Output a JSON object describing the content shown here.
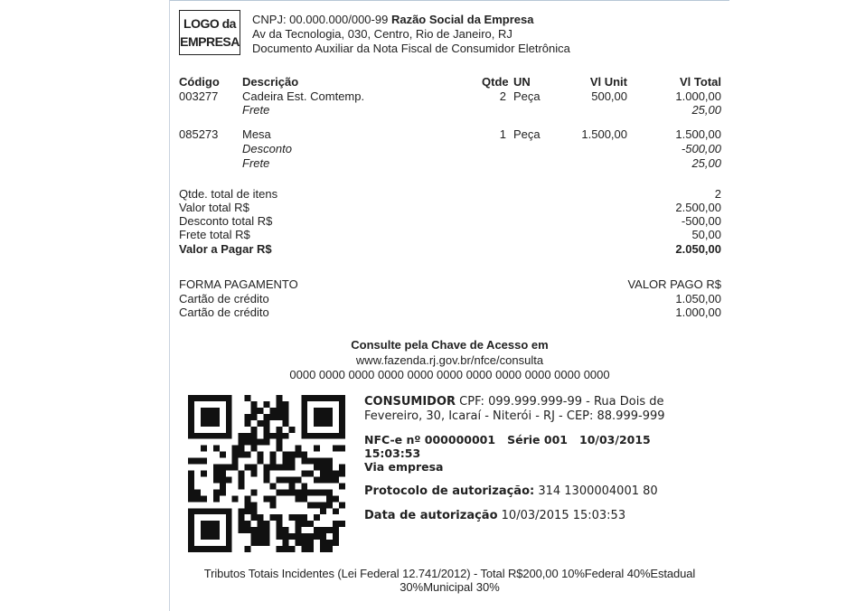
{
  "header": {
    "logo_line1": "LOGO da",
    "logo_line2": "EMPRESA",
    "cnpj": "CNPJ: 00.000.000/000-99",
    "razao_social": "Razão Social da Empresa",
    "address": "Av da Tecnologia, 030, Centro, Rio de Janeiro, RJ",
    "doc_title": "Documento Auxiliar da Nota Fiscal de Consumidor Eletrônica"
  },
  "items_header": {
    "codigo": "Código",
    "descricao": "Descrição",
    "qtde": "Qtde",
    "un": "UN",
    "vl_unit": "Vl Unit",
    "vl_total": "Vl Total"
  },
  "items": [
    {
      "codigo": "003277",
      "descricao": "Cadeira Est. Comtemp.",
      "qtde": "2",
      "un": "Peça",
      "vl_unit": "500,00",
      "vl_total": "1.000,00",
      "extras": [
        {
          "label": "Frete",
          "value": "25,00"
        }
      ]
    },
    {
      "codigo": "085273",
      "descricao": "Mesa",
      "qtde": "1",
      "un": "Peça",
      "vl_unit": "1.500,00",
      "vl_total": "1.500,00",
      "extras": [
        {
          "label": "Desconto",
          "value": "-500,00"
        },
        {
          "label": "Frete",
          "value": "25,00"
        }
      ]
    }
  ],
  "totals": [
    {
      "label": "Qtde. total de itens",
      "value": "2"
    },
    {
      "label": "Valor total R$",
      "value": "2.500,00"
    },
    {
      "label": "Desconto total R$",
      "value": "-500,00"
    },
    {
      "label": "Frete total R$",
      "value": "50,00"
    },
    {
      "label": "Valor a Pagar R$",
      "value": "2.050,00"
    }
  ],
  "payment": {
    "header_left": "FORMA PAGAMENTO",
    "header_right": "VALOR PAGO R$",
    "rows": [
      {
        "method": "Cartão de crédito",
        "value": "1.050,00"
      },
      {
        "method": "Cartão de crédito",
        "value": "1.000,00"
      }
    ]
  },
  "consulta": {
    "title": "Consulte pela Chave de Acesso em",
    "url": "www.fazenda.rj.gov.br/nfce/consulta",
    "chave": "0000 0000 0000 0000 0000 0000 0000 0000 0000 0000 0000"
  },
  "consumidor": {
    "label": "CONSUMIDOR",
    "line1_rest": "CPF: 099.999.999-99 - Rua Dois de",
    "line2": "Fevereiro, 30, Icaraí - Niterói - RJ - CEP: 88.999-999"
  },
  "nfce": {
    "line1": "NFC-e nº 000000001   Série 001   10/03/2015",
    "line2": "15:03:53",
    "via": "Via empresa"
  },
  "protocolo": {
    "label": "Protocolo de autorização:",
    "value": "314 1300004001 80"
  },
  "data_autorizacao": {
    "label": "Data de autorização",
    "value": "10/03/2015 15:03:53"
  },
  "tributos": {
    "line1": "Tributos Totais Incidentes (Lei Federal 12.741/2012) - Total R$200,00 10%Federal 40%Estadual",
    "line2": "30%Municipal 30%"
  }
}
